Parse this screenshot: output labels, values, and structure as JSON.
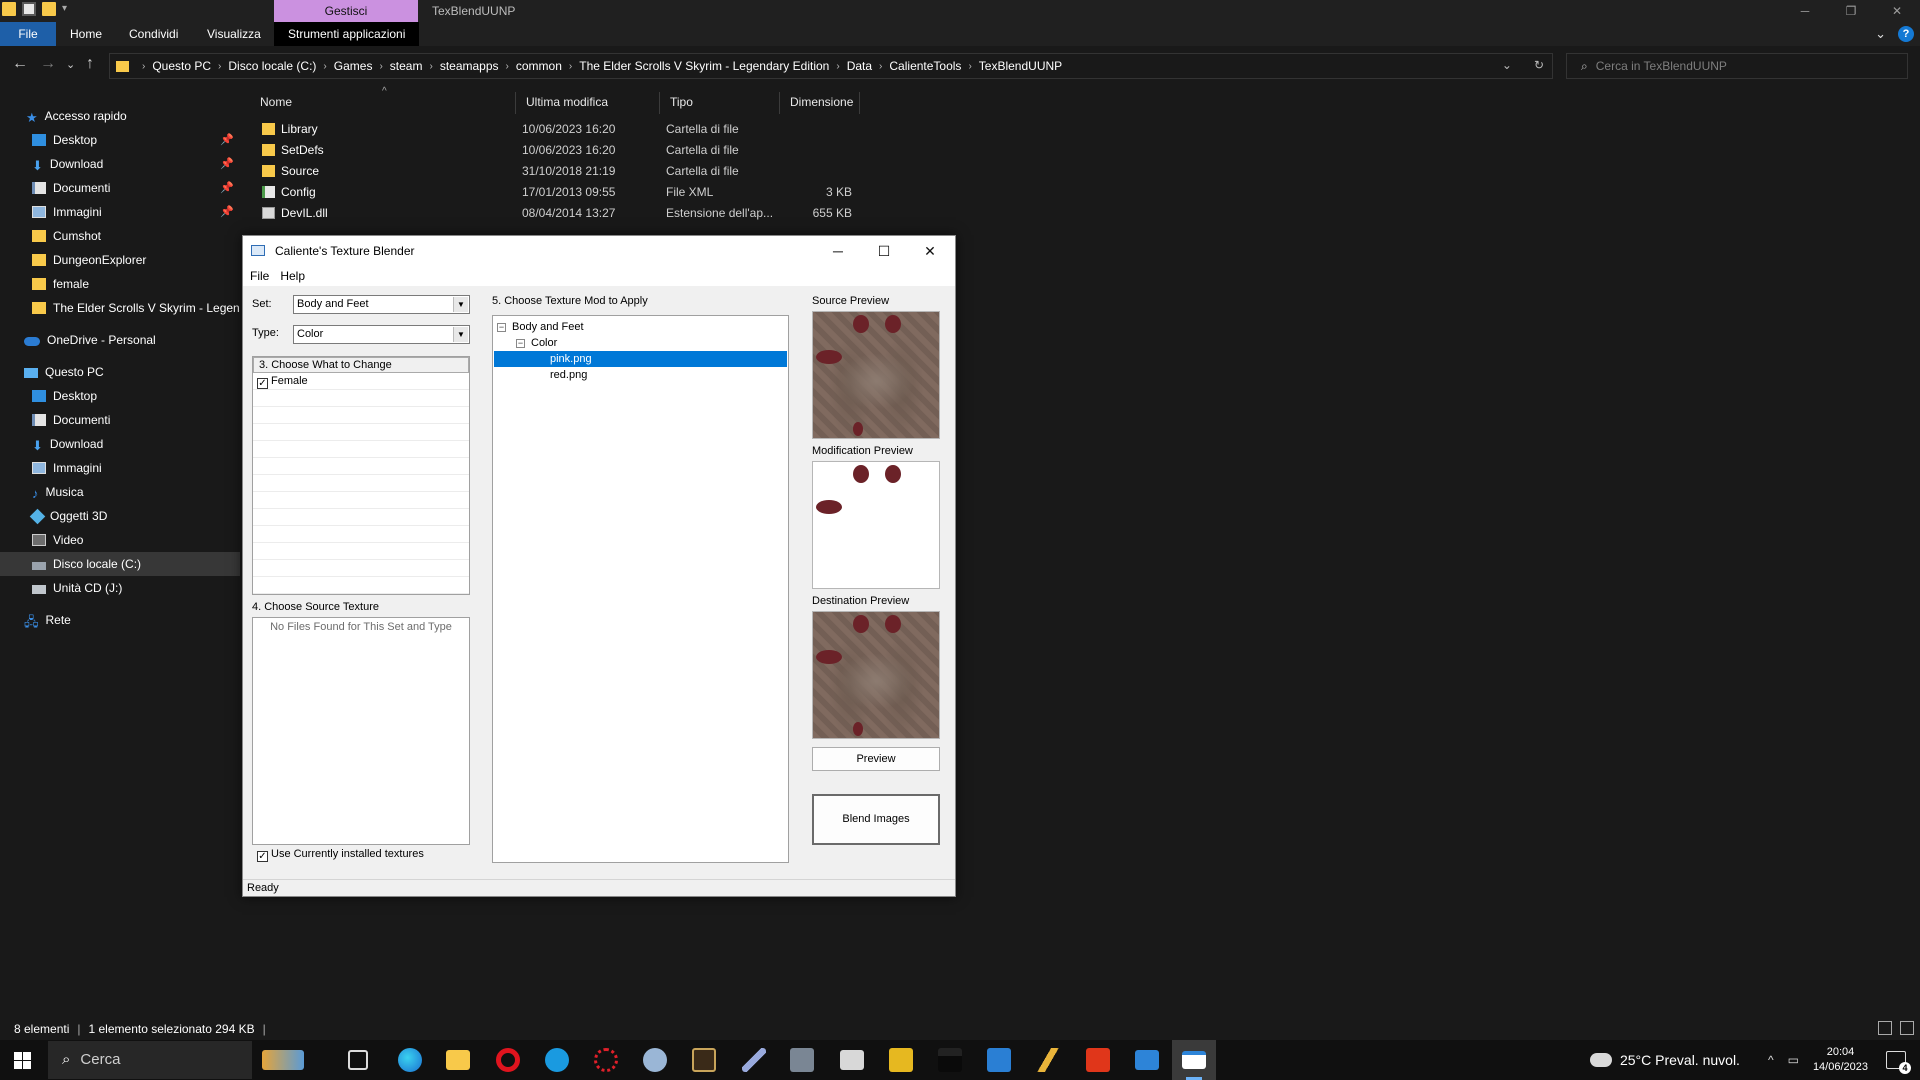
{
  "explorer": {
    "title": "TexBlendUUNP",
    "manage_tab": "Gestisci",
    "ribbon_tabs": [
      "File",
      "Home",
      "Condividi",
      "Visualizza",
      "Strumenti applicazioni"
    ],
    "breadcrumbs": [
      "Questo PC",
      "Disco locale (C:)",
      "Games",
      "steam",
      "steamapps",
      "common",
      "The Elder Scrolls V Skyrim - Legendary Edition",
      "Data",
      "CalienteTools",
      "TexBlendUUNP"
    ],
    "search_placeholder": "Cerca in TexBlendUUNP",
    "columns": {
      "name": "Nome",
      "modified": "Ultima modifica",
      "type": "Tipo",
      "size": "Dimensione"
    },
    "files": [
      {
        "name": "Library",
        "modified": "10/06/2023 16:20",
        "type": "Cartella di file",
        "size": "",
        "icon": "folder-icon"
      },
      {
        "name": "SetDefs",
        "modified": "10/06/2023 16:20",
        "type": "Cartella di file",
        "size": "",
        "icon": "folder-icon"
      },
      {
        "name": "Source",
        "modified": "31/10/2018 21:19",
        "type": "Cartella di file",
        "size": "",
        "icon": "folder-icon"
      },
      {
        "name": "Config",
        "modified": "17/01/2013 09:55",
        "type": "File XML",
        "size": "3 KB",
        "icon": "xml-file-icon"
      },
      {
        "name": "DevIL.dll",
        "modified": "08/04/2014 13:27",
        "type": "Estensione dell'ap...",
        "size": "655 KB",
        "icon": "dll-file-icon"
      }
    ],
    "status": {
      "count": "8 elementi",
      "selected": "1 elemento selezionato  294 KB"
    }
  },
  "sidebar": {
    "quick_access": "Accesso rapido",
    "quick_items": [
      {
        "label": "Desktop",
        "icon": "desktop-icon",
        "pinned": true
      },
      {
        "label": "Download",
        "icon": "download-icon",
        "pinned": true
      },
      {
        "label": "Documenti",
        "icon": "documents-icon",
        "pinned": true
      },
      {
        "label": "Immagini",
        "icon": "pictures-icon",
        "pinned": true
      },
      {
        "label": "Cumshot",
        "icon": "folder-icon",
        "pinned": false
      },
      {
        "label": "DungeonExplorer",
        "icon": "folder-icon",
        "pinned": false
      },
      {
        "label": "female",
        "icon": "folder-icon",
        "pinned": false
      },
      {
        "label": "The Elder Scrolls V Skyrim - Legendary Edition",
        "icon": "folder-icon",
        "pinned": false
      }
    ],
    "onedrive": "OneDrive - Personal",
    "this_pc": "Questo PC",
    "pc_items": [
      {
        "label": "Desktop",
        "icon": "desktop-icon"
      },
      {
        "label": "Documenti",
        "icon": "documents-icon"
      },
      {
        "label": "Download",
        "icon": "download-icon"
      },
      {
        "label": "Immagini",
        "icon": "pictures-icon"
      },
      {
        "label": "Musica",
        "icon": "music-icon"
      },
      {
        "label": "Oggetti 3D",
        "icon": "3d-objects-icon"
      },
      {
        "label": "Video",
        "icon": "video-icon"
      },
      {
        "label": "Disco locale (C:)",
        "icon": "drive-icon",
        "selected": true
      },
      {
        "label": "Unità CD (J:)",
        "icon": "cd-drive-icon"
      }
    ],
    "network": "Rete"
  },
  "blender": {
    "title": "Caliente's Texture Blender",
    "menu": [
      "File",
      "Help"
    ],
    "set_label": "Set:",
    "set_value": "Body and Feet",
    "type_label": "Type:",
    "type_value": "Color",
    "section3": "3. Choose What to Change",
    "change_items": [
      {
        "label": "Female",
        "checked": true
      }
    ],
    "section4": "4. Choose Source Texture",
    "no_files": "No Files Found for This Set and Type",
    "use_installed": "Use Currently installed textures",
    "section5": "5. Choose Texture Mod to Apply",
    "tree": {
      "root": "Body and Feet",
      "child": "Color",
      "files": [
        "pink.png",
        "red.png"
      ],
      "selected": "pink.png"
    },
    "source_preview": "Source Preview",
    "mod_preview": "Modification Preview",
    "dest_preview": "Destination Preview",
    "preview_button": "Preview",
    "blend_button": "Blend Images",
    "status": "Ready"
  },
  "taskbar": {
    "search": "Cerca",
    "weather": "25°C  Preval. nuvol.",
    "time": "20:04",
    "date": "14/06/2023",
    "notifications": "4"
  }
}
